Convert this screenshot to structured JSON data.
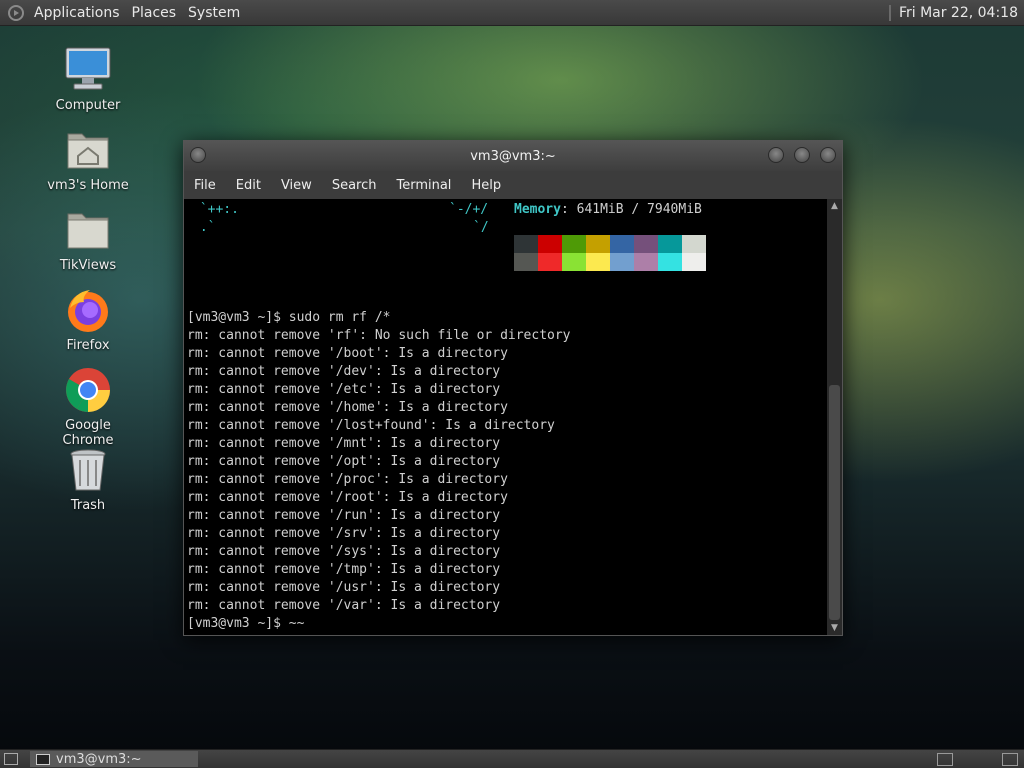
{
  "top_panel": {
    "menus": [
      "Applications",
      "Places",
      "System"
    ],
    "clock": "Fri Mar 22, 04:18"
  },
  "desktop_icons": [
    {
      "label": "Computer",
      "icon": "computer-icon"
    },
    {
      "label": "vm3's Home",
      "icon": "home-folder-icon"
    },
    {
      "label": "TikViews",
      "icon": "folder-icon"
    },
    {
      "label": "Firefox",
      "icon": "firefox-icon"
    },
    {
      "label": "Google Chrome",
      "icon": "chrome-icon"
    },
    {
      "label": "Trash",
      "icon": "trash-icon"
    }
  ],
  "terminal": {
    "title": "vm3@vm3:~",
    "menus": [
      "File",
      "Edit",
      "View",
      "Search",
      "Terminal",
      "Help"
    ],
    "ascii_left_1": " `++:.",
    "ascii_right_1": "`-/+/",
    "ascii_left_2": " .`",
    "ascii_right_2": "`/",
    "memory_label": "Memory",
    "memory_value": ": 641MiB / 7940MiB",
    "palette_top": [
      "#2e3436",
      "#cc0000",
      "#4e9a06",
      "#c4a000",
      "#3465a4",
      "#75507b",
      "#06989a",
      "#d3d7cf"
    ],
    "palette_bottom": [
      "#555753",
      "#ef2929",
      "#8ae234",
      "#fce94f",
      "#729fcf",
      "#ad7fa8",
      "#34e2e2",
      "#eeeeec"
    ],
    "lines": [
      "[vm3@vm3 ~]$ sudo rm rf /*",
      "rm: cannot remove 'rf': No such file or directory",
      "rm: cannot remove '/boot': Is a directory",
      "rm: cannot remove '/dev': Is a directory",
      "rm: cannot remove '/etc': Is a directory",
      "rm: cannot remove '/home': Is a directory",
      "rm: cannot remove '/lost+found': Is a directory",
      "rm: cannot remove '/mnt': Is a directory",
      "rm: cannot remove '/opt': Is a directory",
      "rm: cannot remove '/proc': Is a directory",
      "rm: cannot remove '/root': Is a directory",
      "rm: cannot remove '/run': Is a directory",
      "rm: cannot remove '/srv': Is a directory",
      "rm: cannot remove '/sys': Is a directory",
      "rm: cannot remove '/tmp': Is a directory",
      "rm: cannot remove '/usr': Is a directory",
      "rm: cannot remove '/var': Is a directory",
      "[vm3@vm3 ~]$ ~~"
    ]
  },
  "bottom_panel": {
    "task_label": "vm3@vm3:~"
  }
}
